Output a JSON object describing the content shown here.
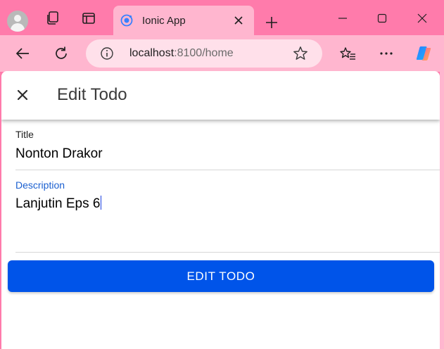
{
  "browser": {
    "tab_title": "Ionic App",
    "url_host": "localhost",
    "url_rest": ":8100/home",
    "icons": {
      "profile": "profile-avatar-icon",
      "workspaces": "workspaces-icon",
      "vertical_tabs": "tab-actions-icon",
      "favicon": "ionic-favicon-icon",
      "tab_close": "close-icon",
      "new_tab": "plus-icon",
      "minimize": "minimize-icon",
      "maximize": "maximize-icon",
      "close_window": "close-icon",
      "back": "back-arrow-icon",
      "refresh": "refresh-icon",
      "site_info": "info-icon",
      "favorite": "star-icon",
      "favorites_list": "favorites-icon",
      "more": "more-icon",
      "copilot": "copilot-icon"
    },
    "colors": {
      "frame": "#ff7bab",
      "toolbar": "#ffb6cf",
      "omnibox": "#ffe0ea"
    }
  },
  "app": {
    "header": {
      "title": "Edit Todo",
      "close_icon": "close-icon"
    },
    "form": {
      "title_label": "Title",
      "title_value": "Nonton Drakor",
      "description_label": "Description",
      "description_value": "Lanjutin Eps 6"
    },
    "submit_label": "EDIT TODO",
    "colors": {
      "primary": "#0054e9",
      "focused_label": "#1a5fd0"
    }
  }
}
